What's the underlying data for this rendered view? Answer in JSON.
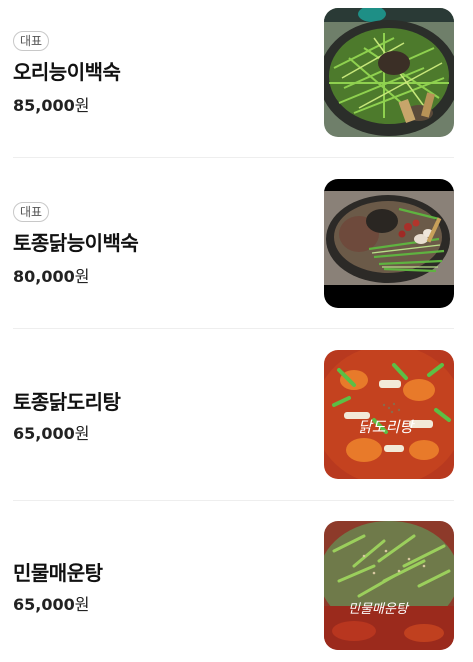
{
  "menu": {
    "items": [
      {
        "badge": "대표",
        "name": "오리능이백숙",
        "price_number": "85,000",
        "price_unit": "원",
        "image": "duck-neungi-baeksuk-photo"
      },
      {
        "badge": "대표",
        "name": "토종닭능이백숙",
        "price_number": "80,000",
        "price_unit": "원",
        "image": "native-chicken-neungi-baeksuk-photo"
      },
      {
        "name": "토종닭도리탕",
        "price_number": "65,000",
        "price_unit": "원",
        "image": "native-chicken-dakdoritang-photo",
        "image_caption": "닭도리탕"
      },
      {
        "name": "민물매운탕",
        "price_number": "65,000",
        "price_unit": "원",
        "image": "freshwater-spicy-fish-stew-photo",
        "image_caption": "민물매운탕"
      }
    ]
  },
  "colors": {
    "text_primary": "#111111",
    "badge_border": "#c8c8c8",
    "divider": "#eeeeee"
  }
}
